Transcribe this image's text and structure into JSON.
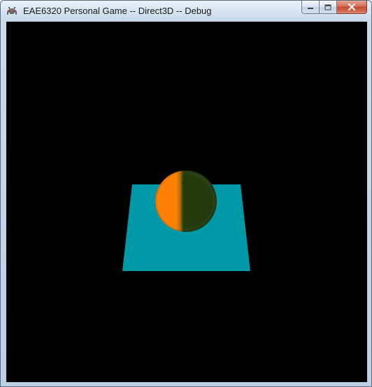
{
  "window": {
    "title": "EAE6320 Personal Game -- Direct3D -- Debug",
    "icon": "space-invader-icon"
  },
  "caption_buttons": {
    "minimize": "minimize-icon",
    "maximize": "maximize-icon",
    "close": "close-icon"
  },
  "scene": {
    "background_color": "#000000",
    "plane_color": "#0099a8",
    "sphere_lit_color": "#ff8000",
    "sphere_shadow_color": "#233a0d"
  }
}
